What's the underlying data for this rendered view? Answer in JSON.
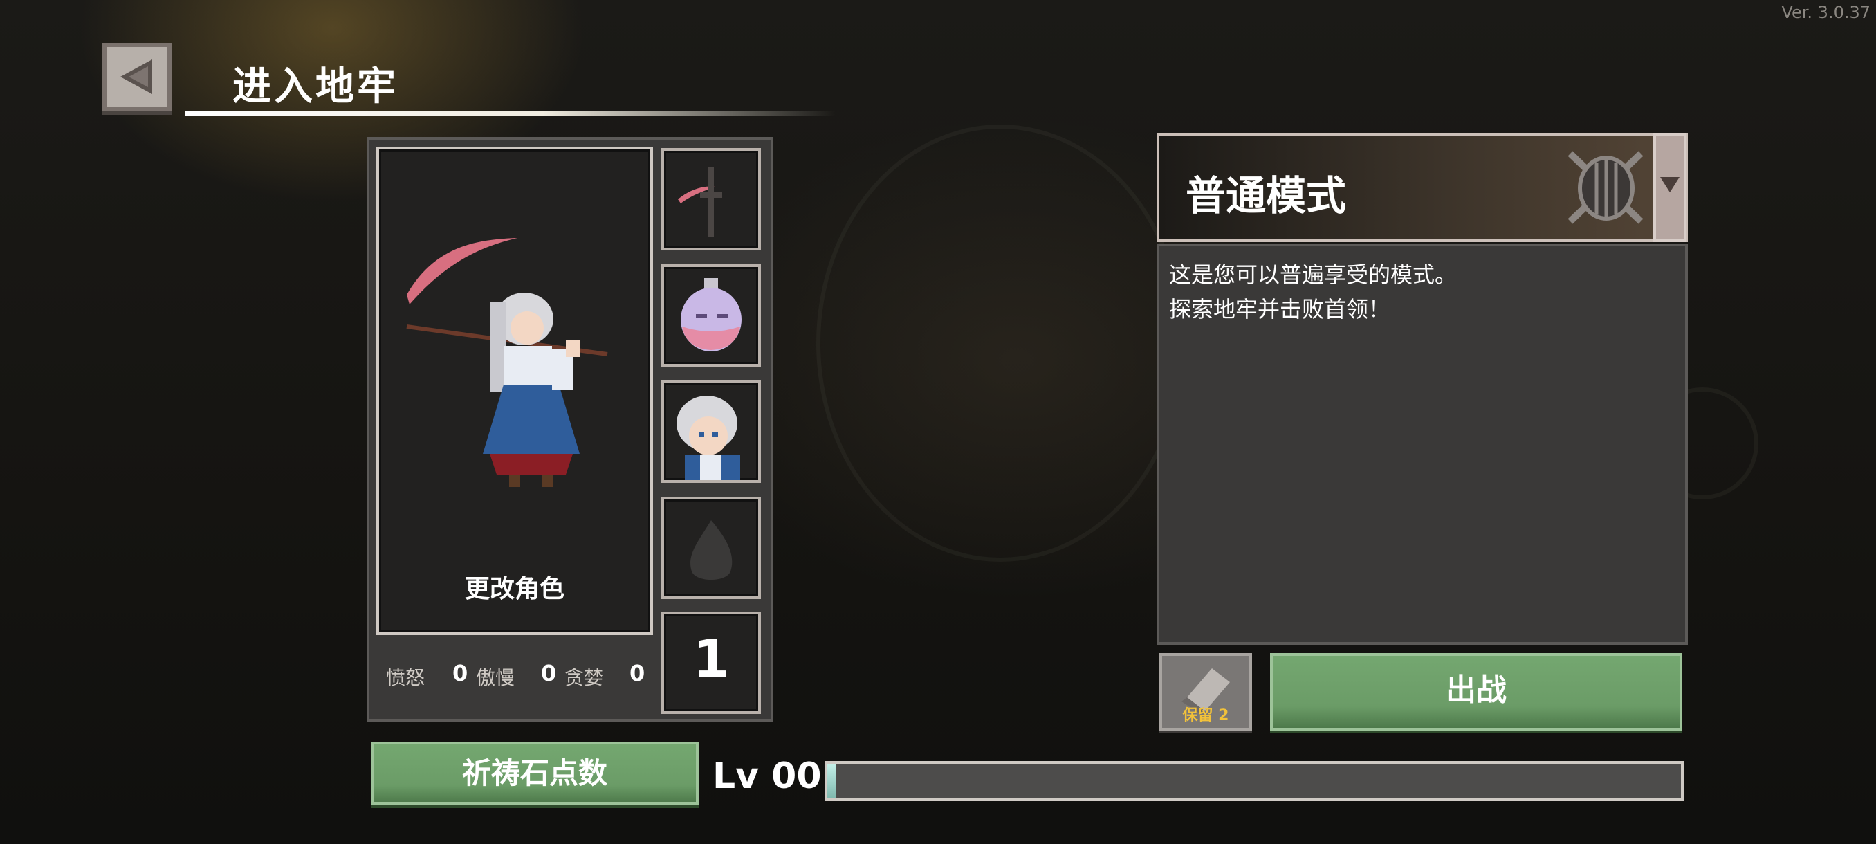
{
  "version": "Ver. 3.0.37",
  "header": {
    "title": "进入地牢",
    "back_icon": "back-arrow-icon"
  },
  "character": {
    "change_label": "更改角色",
    "slots": [
      {
        "icon": "scythe-weapon-icon"
      },
      {
        "icon": "potion-icon"
      },
      {
        "icon": "character-portrait-icon"
      },
      {
        "icon": "locked-flame-icon"
      }
    ],
    "count": "1",
    "sins": [
      {
        "label": "愤怒",
        "value": "0"
      },
      {
        "label": "傲慢",
        "value": "0"
      },
      {
        "label": "贪婪",
        "value": "0"
      }
    ]
  },
  "mode": {
    "title": "普通模式",
    "icon": "shield-swords-icon",
    "description_line1": "这是您可以普遍享受的模式。",
    "description_line2": "探索地牢并击败首领！"
  },
  "actions": {
    "keep_label": "保留 2",
    "go_label": "出战",
    "prayer_label": "祈祷石点数"
  },
  "level": {
    "label": "Lv 00",
    "progress": 0.01
  },
  "colors": {
    "accent_green": "#6b9c67",
    "panel": "#3a3938",
    "keep_text": "#f2c23a"
  }
}
